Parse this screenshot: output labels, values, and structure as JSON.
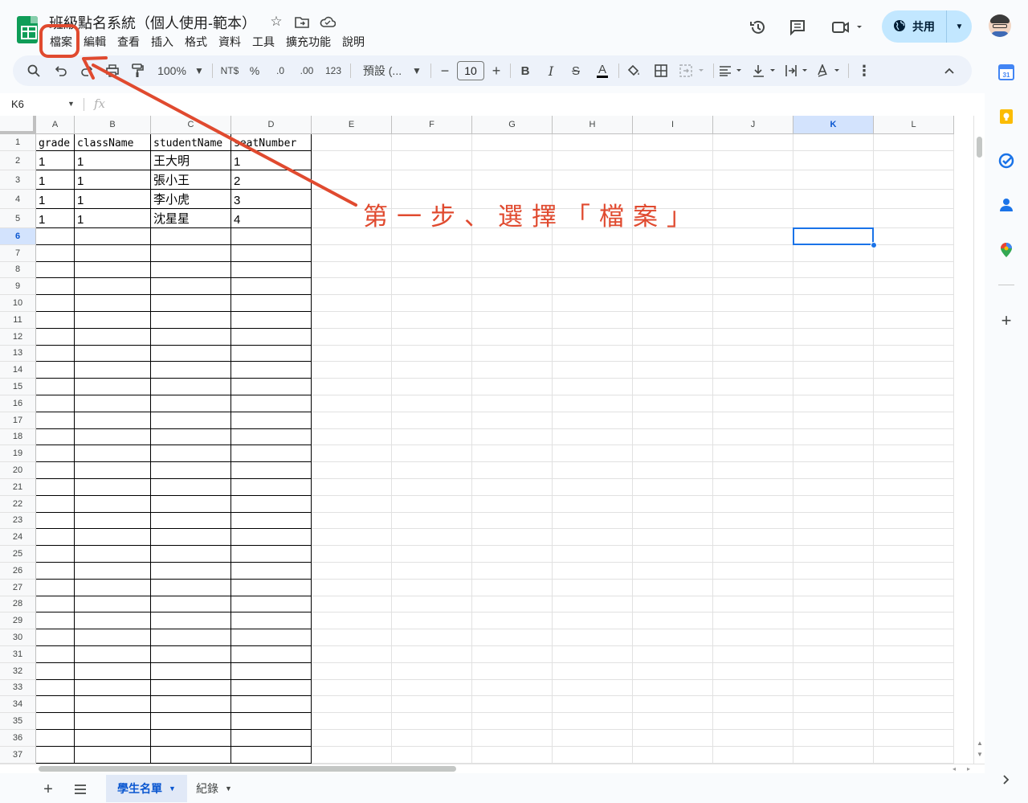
{
  "document": {
    "title": "班級點名系統（個人使用-範本）",
    "menu": [
      "檔案",
      "編輯",
      "查看",
      "插入",
      "格式",
      "資料",
      "工具",
      "擴充功能",
      "說明"
    ],
    "share_label": "共用"
  },
  "toolbar": {
    "zoom": "100%",
    "currency": "NT$",
    "percent": "%",
    "dec_decrease": ".0",
    "dec_increase": ".00",
    "number_format": "123",
    "font": "預設 (...",
    "font_size": "10",
    "bold": "B",
    "italic": "I",
    "strike": "S",
    "text_color_glyph": "A"
  },
  "formula_bar": {
    "name_box": "K6",
    "fx": "fx",
    "value": ""
  },
  "sheet": {
    "columns": [
      "A",
      "B",
      "C",
      "D",
      "E",
      "F",
      "G",
      "H",
      "I",
      "J",
      "K",
      "L"
    ],
    "selected_column": "K",
    "selected_row": "6",
    "selected_cell": "K6",
    "row_numbers": [
      "1",
      "2",
      "3",
      "4",
      "5",
      "6",
      "7",
      "8",
      "9",
      "10",
      "11",
      "12",
      "13",
      "14",
      "15",
      "16",
      "17",
      "18",
      "19",
      "20",
      "21",
      "22",
      "23",
      "24",
      "25",
      "26",
      "27",
      "28",
      "29",
      "30",
      "31",
      "32",
      "33",
      "34",
      "35",
      "36",
      "37"
    ],
    "cells": [
      [
        "grade",
        "className",
        "studentName",
        "seatNumber"
      ],
      [
        "1",
        "1",
        "王大明",
        "1"
      ],
      [
        "1",
        "1",
        "張小王",
        "2"
      ],
      [
        "1",
        "1",
        "李小虎",
        "3"
      ],
      [
        "1",
        "1",
        "沈星星",
        "4"
      ]
    ]
  },
  "sheet_tabs": [
    {
      "label": "學生名單",
      "active": true
    },
    {
      "label": "紀錄",
      "active": false
    }
  ],
  "annotation": {
    "text": "第一步、選擇「檔案」",
    "color": "#e04a2f"
  },
  "colors": {
    "accent": "#1a73e8",
    "share_bg": "#c2e7ff",
    "selected_header": "#d3e3fd",
    "sheets_green": "#0f9d58"
  }
}
